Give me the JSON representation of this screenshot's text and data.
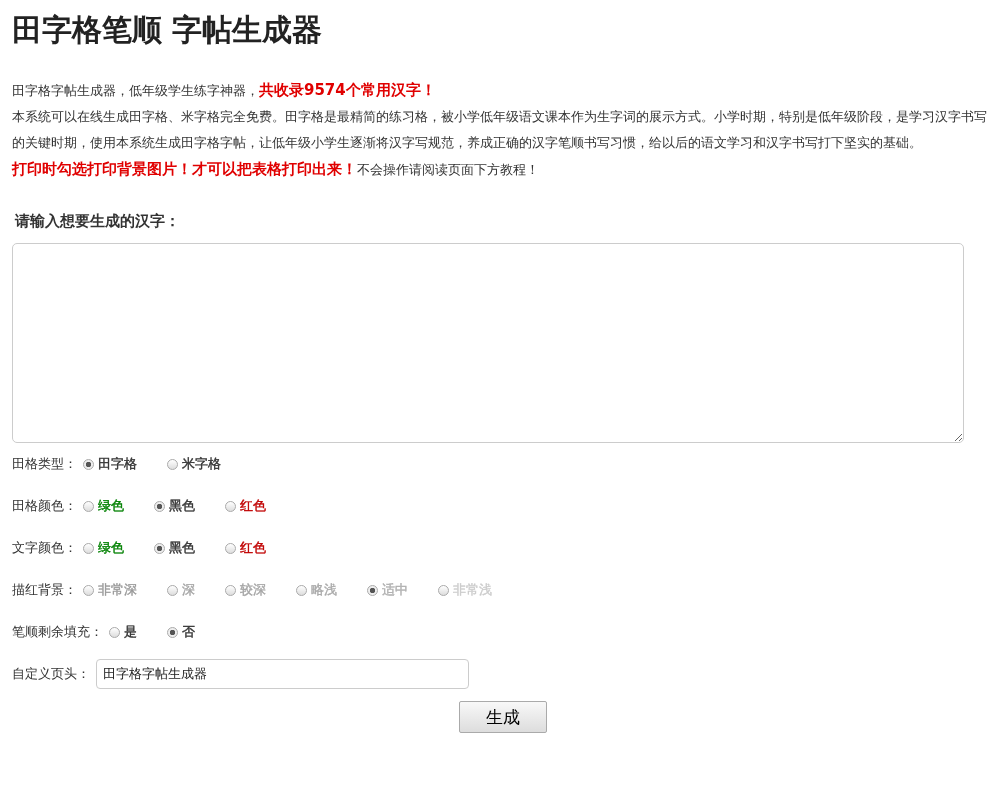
{
  "title": "田字格笔顺 字帖生成器",
  "intro": {
    "text": "田字格字帖生成器，低年级学生练字神器，",
    "highlight": "共收录9574个常用汉字！"
  },
  "description": "本系统可以在线生成田字格、米字格完全免费。田字格是最精简的练习格，被小学低年级语文课本作为生字词的展示方式。小学时期，特别是低年级阶段，是学习汉字书写的关键时期，使用本系统生成田字格字帖，让低年级小学生逐渐将汉字写规范，养成正确的汉字笔顺书写习惯，给以后的语文学习和汉字书写打下坚实的基础。",
  "print_notice": {
    "warning": "打印时勾选打印背景图片！才可以把表格打印出来！",
    "hint": "不会操作请阅读页面下方教程！"
  },
  "input_label": "请输入想要生成的汉字：",
  "option_groups": [
    {
      "label": "田格类型：",
      "options": [
        {
          "label": "田字格",
          "selected": true
        },
        {
          "label": "米字格",
          "selected": false
        }
      ]
    },
    {
      "label": "田格颜色：",
      "options": [
        {
          "label": "绿色",
          "selected": false,
          "color": "#008000"
        },
        {
          "label": "黑色",
          "selected": true,
          "color": "#333333"
        },
        {
          "label": "红色",
          "selected": false,
          "color": "#c00000"
        }
      ]
    },
    {
      "label": "文字颜色：",
      "options": [
        {
          "label": "绿色",
          "selected": false,
          "color": "#008000"
        },
        {
          "label": "黑色",
          "selected": true,
          "color": "#333333"
        },
        {
          "label": "红色",
          "selected": false,
          "color": "#c00000"
        }
      ]
    },
    {
      "label": "描红背景：",
      "options": [
        {
          "label": "非常深",
          "selected": false,
          "color": "#999999"
        },
        {
          "label": "深",
          "selected": false,
          "color": "#a6a6a6"
        },
        {
          "label": "较深",
          "selected": false,
          "color": "#a6a6a6"
        },
        {
          "label": "略浅",
          "selected": false,
          "color": "#aaaaaa"
        },
        {
          "label": "适中",
          "selected": true,
          "color": "#b0b0b0"
        },
        {
          "label": "非常浅",
          "selected": false,
          "color": "#cccccc"
        }
      ]
    },
    {
      "label": "笔顺剩余填充：",
      "options": [
        {
          "label": "是",
          "selected": false
        },
        {
          "label": "否",
          "selected": true
        }
      ]
    }
  ],
  "header_field": {
    "label": "自定义页头：",
    "value": "田字格字帖生成器"
  },
  "buttons": [
    "生成"
  ]
}
